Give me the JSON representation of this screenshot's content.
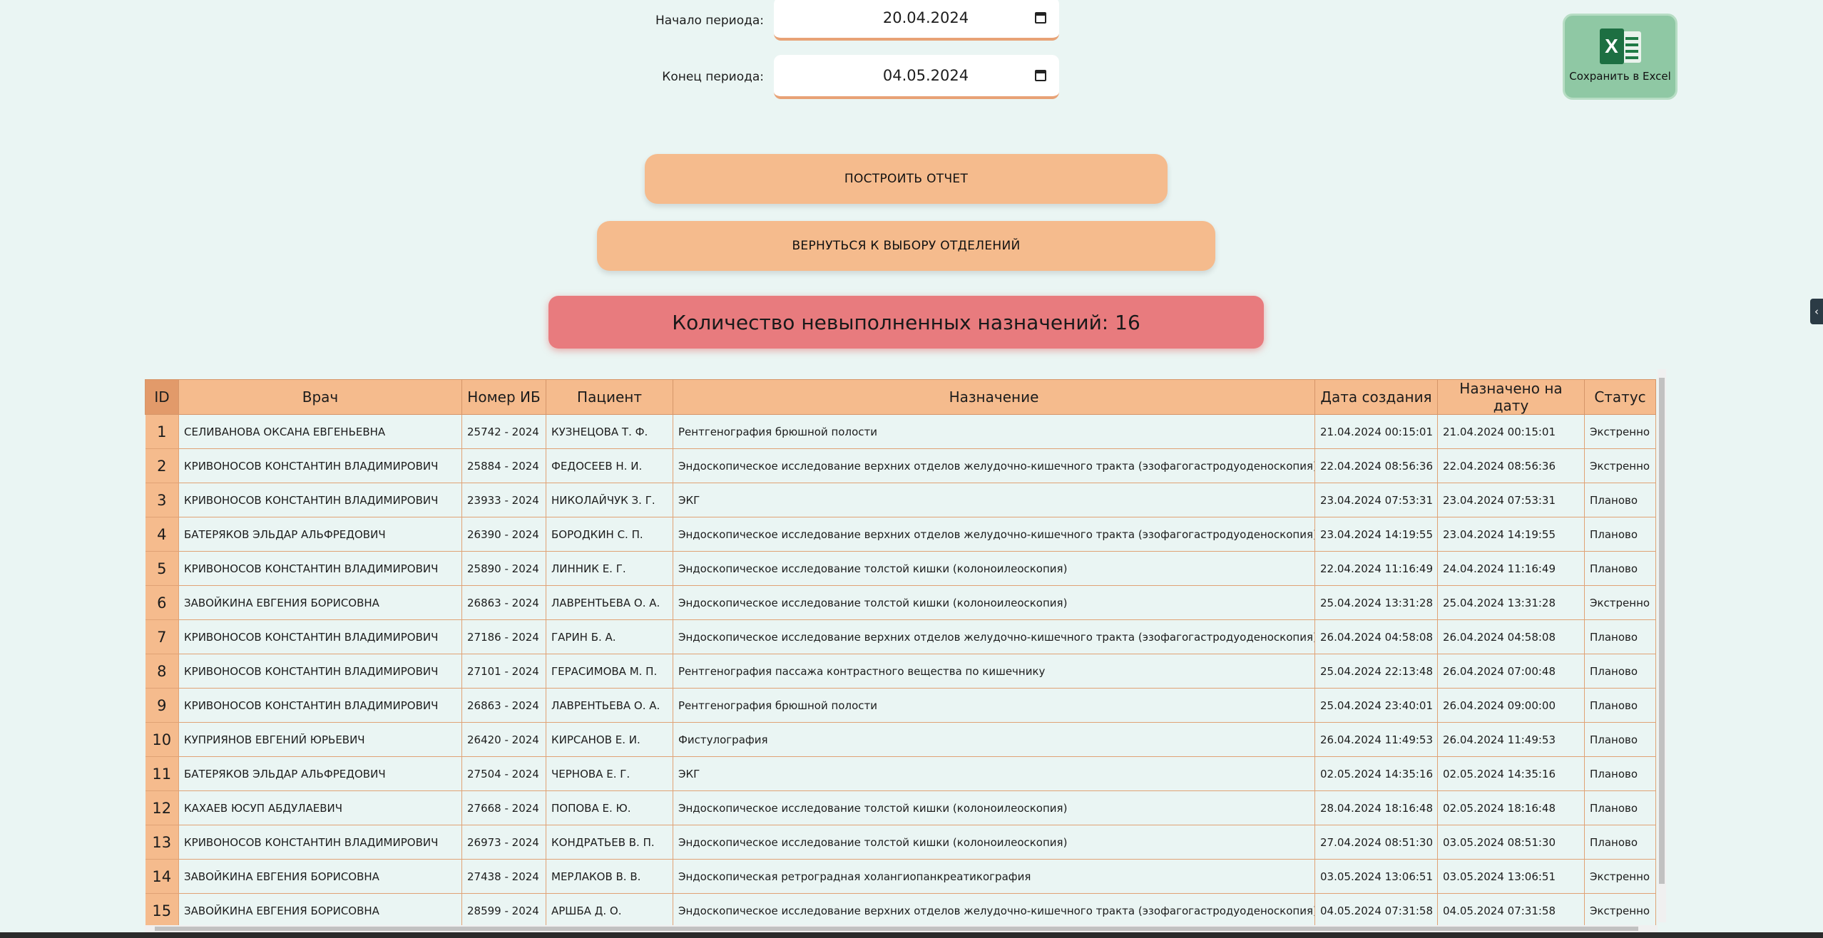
{
  "period": {
    "start_label": "Начало периода:",
    "start_value": "20.04.2024",
    "end_label": "Конец периода:",
    "end_value": "04.05.2024"
  },
  "excel": {
    "label": "Сохранить в Excel",
    "icon": "excel-icon"
  },
  "buttons": {
    "build_report": "ПОСТРОИТЬ ОТЧЕТ",
    "back_to_departments": "ВЕРНУТЬСЯ К ВЫБОРУ ОТДЕЛЕНИЙ"
  },
  "summary": {
    "text": "Количество невыполненных назначений: 16",
    "color": "#e87b7e"
  },
  "table": {
    "headers": [
      "ID",
      "Врач",
      "Номер ИБ",
      "Пациент",
      "Назначение",
      "Дата создания",
      "Назначено на дату",
      "Статус"
    ],
    "rows": [
      [
        "1",
        "СЕЛИВАНОВА ОКСАНА ЕВГЕНЬЕВНА",
        "25742 - 2024",
        "КУЗНЕЦОВА Т. Ф.",
        "Рентгенография брюшной полости",
        "21.04.2024 00:15:01",
        "21.04.2024 00:15:01",
        "Экстренно"
      ],
      [
        "2",
        "КРИВОНОСОВ КОНСТАНТИН ВЛАДИМИРОВИЧ",
        "25884 - 2024",
        "ФЕДОСЕЕВ Н. И.",
        "Эндоскопическое исследование верхних отделов желудочно-кишечного тракта (эзофагогастродуоденоскопия)",
        "22.04.2024 08:56:36",
        "22.04.2024 08:56:36",
        "Экстренно"
      ],
      [
        "3",
        "КРИВОНОСОВ КОНСТАНТИН ВЛАДИМИРОВИЧ",
        "23933 - 2024",
        "НИКОЛАЙЧУК З. Г.",
        "ЭКГ",
        "23.04.2024 07:53:31",
        "23.04.2024 07:53:31",
        "Планово"
      ],
      [
        "4",
        "БАТЕРЯКОВ ЭЛЬДАР АЛЬФРЕДОВИЧ",
        "26390 - 2024",
        "БОРОДКИН С. П.",
        "Эндоскопическое исследование верхних отделов желудочно-кишечного тракта (эзофагогастродуоденоскопия)",
        "23.04.2024 14:19:55",
        "23.04.2024 14:19:55",
        "Планово"
      ],
      [
        "5",
        "КРИВОНОСОВ КОНСТАНТИН ВЛАДИМИРОВИЧ",
        "25890 - 2024",
        "ЛИННИК Е. Г.",
        "Эндоскопическое исследование толстой кишки (колоноилеоскопия)",
        "22.04.2024 11:16:49",
        "24.04.2024 11:16:49",
        "Планово"
      ],
      [
        "6",
        "ЗАВОЙКИНА ЕВГЕНИЯ БОРИСОВНА",
        "26863 - 2024",
        "ЛАВРЕНТЬЕВА О. А.",
        "Эндоскопическое исследование толстой кишки (колоноилеоскопия)",
        "25.04.2024 13:31:28",
        "25.04.2024 13:31:28",
        "Экстренно"
      ],
      [
        "7",
        "КРИВОНОСОВ КОНСТАНТИН ВЛАДИМИРОВИЧ",
        "27186 - 2024",
        "ГАРИН Б. А.",
        "Эндоскопическое исследование верхних отделов желудочно-кишечного тракта (эзофагогастродуоденоскопия)",
        "26.04.2024 04:58:08",
        "26.04.2024 04:58:08",
        "Планово"
      ],
      [
        "8",
        "КРИВОНОСОВ КОНСТАНТИН ВЛАДИМИРОВИЧ",
        "27101 - 2024",
        "ГЕРАСИМОВА М. П.",
        "Рентгенография пассажа контрастного вещества по кишечнику",
        "25.04.2024 22:13:48",
        "26.04.2024 07:00:48",
        "Планово"
      ],
      [
        "9",
        "КРИВОНОСОВ КОНСТАНТИН ВЛАДИМИРОВИЧ",
        "26863 - 2024",
        "ЛАВРЕНТЬЕВА О. А.",
        "Рентгенография брюшной полости",
        "25.04.2024 23:40:01",
        "26.04.2024 09:00:00",
        "Планово"
      ],
      [
        "10",
        "КУПРИЯНОВ ЕВГЕНИЙ ЮРЬЕВИЧ",
        "26420 - 2024",
        "КИРСАНОВ Е. И.",
        "Фистулография",
        "26.04.2024 11:49:53",
        "26.04.2024 11:49:53",
        "Планово"
      ],
      [
        "11",
        "БАТЕРЯКОВ ЭЛЬДАР АЛЬФРЕДОВИЧ",
        "27504 - 2024",
        "ЧЕРНОВА Е. Г.",
        "ЭКГ",
        "02.05.2024 14:35:16",
        "02.05.2024 14:35:16",
        "Планово"
      ],
      [
        "12",
        "КАХАЕВ ЮСУП АБДУЛАЕВИЧ",
        "27668 - 2024",
        "ПОПОВА Е. Ю.",
        "Эндоскопическое исследование толстой кишки (колоноилеоскопия)",
        "28.04.2024 18:16:48",
        "02.05.2024 18:16:48",
        "Планово"
      ],
      [
        "13",
        "КРИВОНОСОВ КОНСТАНТИН ВЛАДИМИРОВИЧ",
        "26973 - 2024",
        "КОНДРАТЬЕВ В. П.",
        "Эндоскопическое исследование толстой кишки (колоноилеоскопия)",
        "27.04.2024 08:51:30",
        "03.05.2024 08:51:30",
        "Планово"
      ],
      [
        "14",
        "ЗАВОЙКИНА ЕВГЕНИЯ БОРИСОВНА",
        "27438 - 2024",
        "МЕРЛАКОВ В. В.",
        "Эндоскопическая ретроградная холангиопанкреатикография",
        "03.05.2024 13:06:51",
        "03.05.2024 13:06:51",
        "Экстренно"
      ],
      [
        "15",
        "ЗАВОЙКИНА ЕВГЕНИЯ БОРИСОВНА",
        "28599 - 2024",
        "АРШБА Д. О.",
        "Эндоскопическое исследование верхних отделов желудочно-кишечного тракта (эзофагогастродуоденоскопия)",
        "04.05.2024 07:31:58",
        "04.05.2024 07:31:58",
        "Экстренно"
      ]
    ]
  },
  "colors": {
    "background": "#eaf5f3",
    "header": "#f5bb8d",
    "accent_border": "#e8a276",
    "excel_button": "#8fc8a4"
  }
}
